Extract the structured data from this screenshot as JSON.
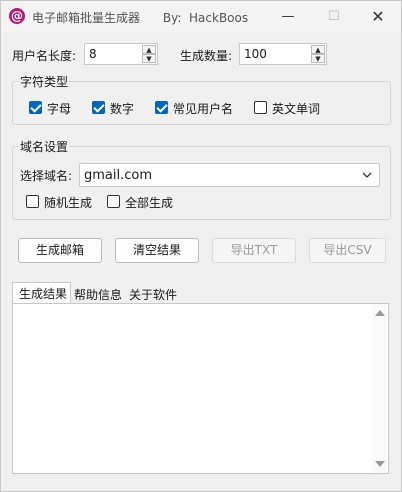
{
  "window": {
    "title": "电子邮箱批量生成器      By:  HackBoos",
    "icon": "at-sign-icon",
    "accent": "#0067c0"
  },
  "fields": {
    "username_length_label": "用户名长度:",
    "username_length_value": "8",
    "count_label": "生成数量:",
    "count_value": "100"
  },
  "char_types": {
    "title": "字符类型",
    "options": [
      {
        "label": "字母",
        "checked": true
      },
      {
        "label": "数字",
        "checked": true
      },
      {
        "label": "常见用户名",
        "checked": true
      },
      {
        "label": "英文单词",
        "checked": false
      }
    ]
  },
  "domain": {
    "title": "域名设置",
    "select_label": "选择域名:",
    "selected": "gmail.com",
    "random_label": "随机生成",
    "random_checked": false,
    "all_label": "全部生成",
    "all_checked": false
  },
  "buttons": {
    "generate": "生成邮箱",
    "clear": "清空结果",
    "export_txt": "导出TXT",
    "export_csv": "导出CSV"
  },
  "tabs": [
    {
      "label": "生成结果",
      "active": true
    },
    {
      "label": "帮助信息",
      "active": false
    },
    {
      "label": "关于软件",
      "active": false
    }
  ]
}
